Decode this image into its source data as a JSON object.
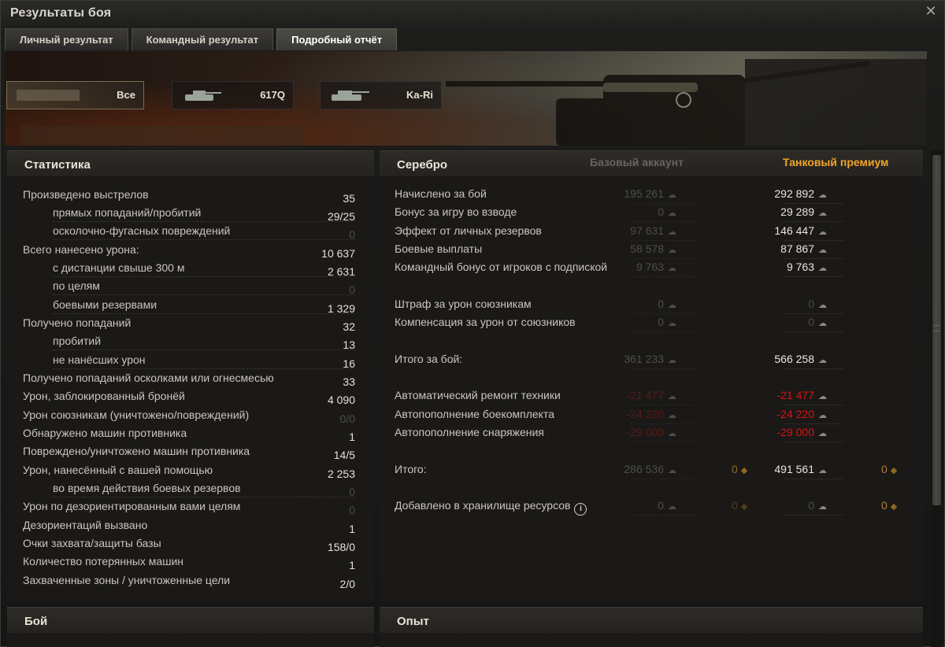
{
  "window": {
    "title": "Результаты боя",
    "close_icon": "close-icon"
  },
  "tabs": [
    {
      "label": "Личный результат"
    },
    {
      "label": "Командный результат"
    },
    {
      "label": "Подробный отчёт",
      "active": true
    }
  ],
  "vehicles": [
    {
      "label": "Все",
      "active": true
    },
    {
      "label": "617Q"
    },
    {
      "label": "Ka-Ri"
    }
  ],
  "stats": {
    "title": "Статистика",
    "rows": [
      {
        "label": "Произведено выстрелов",
        "value": "35"
      },
      {
        "label": "прямых попаданий/пробитий",
        "value": "29/25"
      },
      {
        "label": "осколочно-фугасных повреждений",
        "value": "0"
      },
      {
        "label": "Всего нанесено урона:",
        "value": "10 637"
      },
      {
        "label": "с дистанции свыше 300 м",
        "value": "2 631"
      },
      {
        "label": "по целям",
        "value": "0"
      },
      {
        "label": "боевыми резервами",
        "value": "1 329"
      },
      {
        "label": "Получено попаданий",
        "value": "32"
      },
      {
        "label": "пробитий",
        "value": "13"
      },
      {
        "label": "не нанёсших урон",
        "value": "16"
      },
      {
        "label": "Получено попаданий осколками или огнесмесью",
        "value": "33"
      },
      {
        "label": "Урон, заблокированный бронёй",
        "value": "4 090"
      },
      {
        "label": "Урон союзникам (уничтожено/повреждений)",
        "value": "0/0"
      },
      {
        "label": "Обнаружено машин противника",
        "value": "1"
      },
      {
        "label": "Повреждено/уничтожено машин противника",
        "value": "14/5"
      },
      {
        "label": "Урон, нанесённый с вашей помощью",
        "value": "2 253"
      },
      {
        "label": "во время действия боевых резервов",
        "value": "0"
      },
      {
        "label": "Урон по дезориентированным вами целям",
        "value": "0"
      },
      {
        "label": "Дезориентаций вызвано",
        "value": "1"
      },
      {
        "label": "Очки захвата/защиты базы",
        "value": "158/0"
      },
      {
        "label": "Количество потерянных машин",
        "value": "1"
      },
      {
        "label": "Захваченные зоны / уничтоженные цели",
        "value": "2/0"
      }
    ]
  },
  "credits": {
    "title": "Серебро",
    "base_header": "Базовый аккаунт",
    "premium_header": "Танковый премиум",
    "rows": [
      {
        "label": "Начислено за бой",
        "base": "195 261",
        "prem": "292 892"
      },
      {
        "label": "Бонус за игру во взводе",
        "base": "0",
        "prem": "29 289"
      },
      {
        "label": "Эффект от личных резервов",
        "base": "97 631",
        "prem": "146 447"
      },
      {
        "label": "Боевые выплаты",
        "base": "58 578",
        "prem": "87 867"
      },
      {
        "label": "Командный бонус от игроков с подпиской",
        "base": "9 763",
        "prem": "9 763"
      },
      {
        "label": "Штраф за урон союзникам",
        "base": "0",
        "prem": "0"
      },
      {
        "label": "Компенсация за урон от союзников",
        "base": "0",
        "prem": "0"
      },
      {
        "label": "Итого за бой:",
        "base": "361 233",
        "prem": "566 258"
      },
      {
        "label": "Автоматический ремонт техники",
        "base": "-21 477",
        "prem": "-21 477"
      },
      {
        "label": "Автопополнение боекомплекта",
        "base": "-24 220",
        "prem": "-24 220"
      },
      {
        "label": "Автопополнение снаряжения",
        "base": "-29 000",
        "prem": "-29 000"
      },
      {
        "label": "Итого:",
        "base": "286 536",
        "prem": "491 561",
        "base_gold": "0",
        "prem_gold": "0"
      },
      {
        "label": "Добавлено в хранилище ресурсов",
        "base": "0",
        "prem": "0",
        "base_gold": "0",
        "prem_gold": "0"
      }
    ]
  },
  "bottom": {
    "battle_title": "Бой",
    "xp_title": "Опыт"
  },
  "colors": {
    "premium": "#f2a42a",
    "negative": "#e01010",
    "accent": "#d7c39a"
  }
}
